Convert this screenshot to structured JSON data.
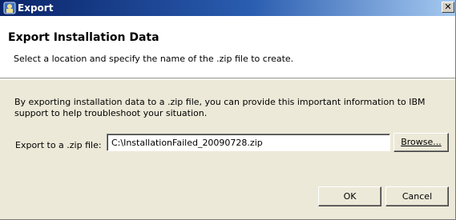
{
  "window": {
    "title": "Export",
    "close_glyph": "✕"
  },
  "header": {
    "title": "Export Installation Data",
    "description": "Select a location and specify the name of the .zip file to create."
  },
  "body": {
    "info_text": "By exporting installation data to a .zip file, you can provide this important information to IBM support to help troubleshoot your situation.",
    "export_label": "Export to a .zip file:",
    "export_path": "C:\\InstallationFailed_20090728.zip"
  },
  "buttons": {
    "browse": "Browse...",
    "ok": "OK",
    "cancel": "Cancel"
  },
  "icons": {
    "title_icon": "installation-manager-icon",
    "close_icon": "close-icon"
  }
}
